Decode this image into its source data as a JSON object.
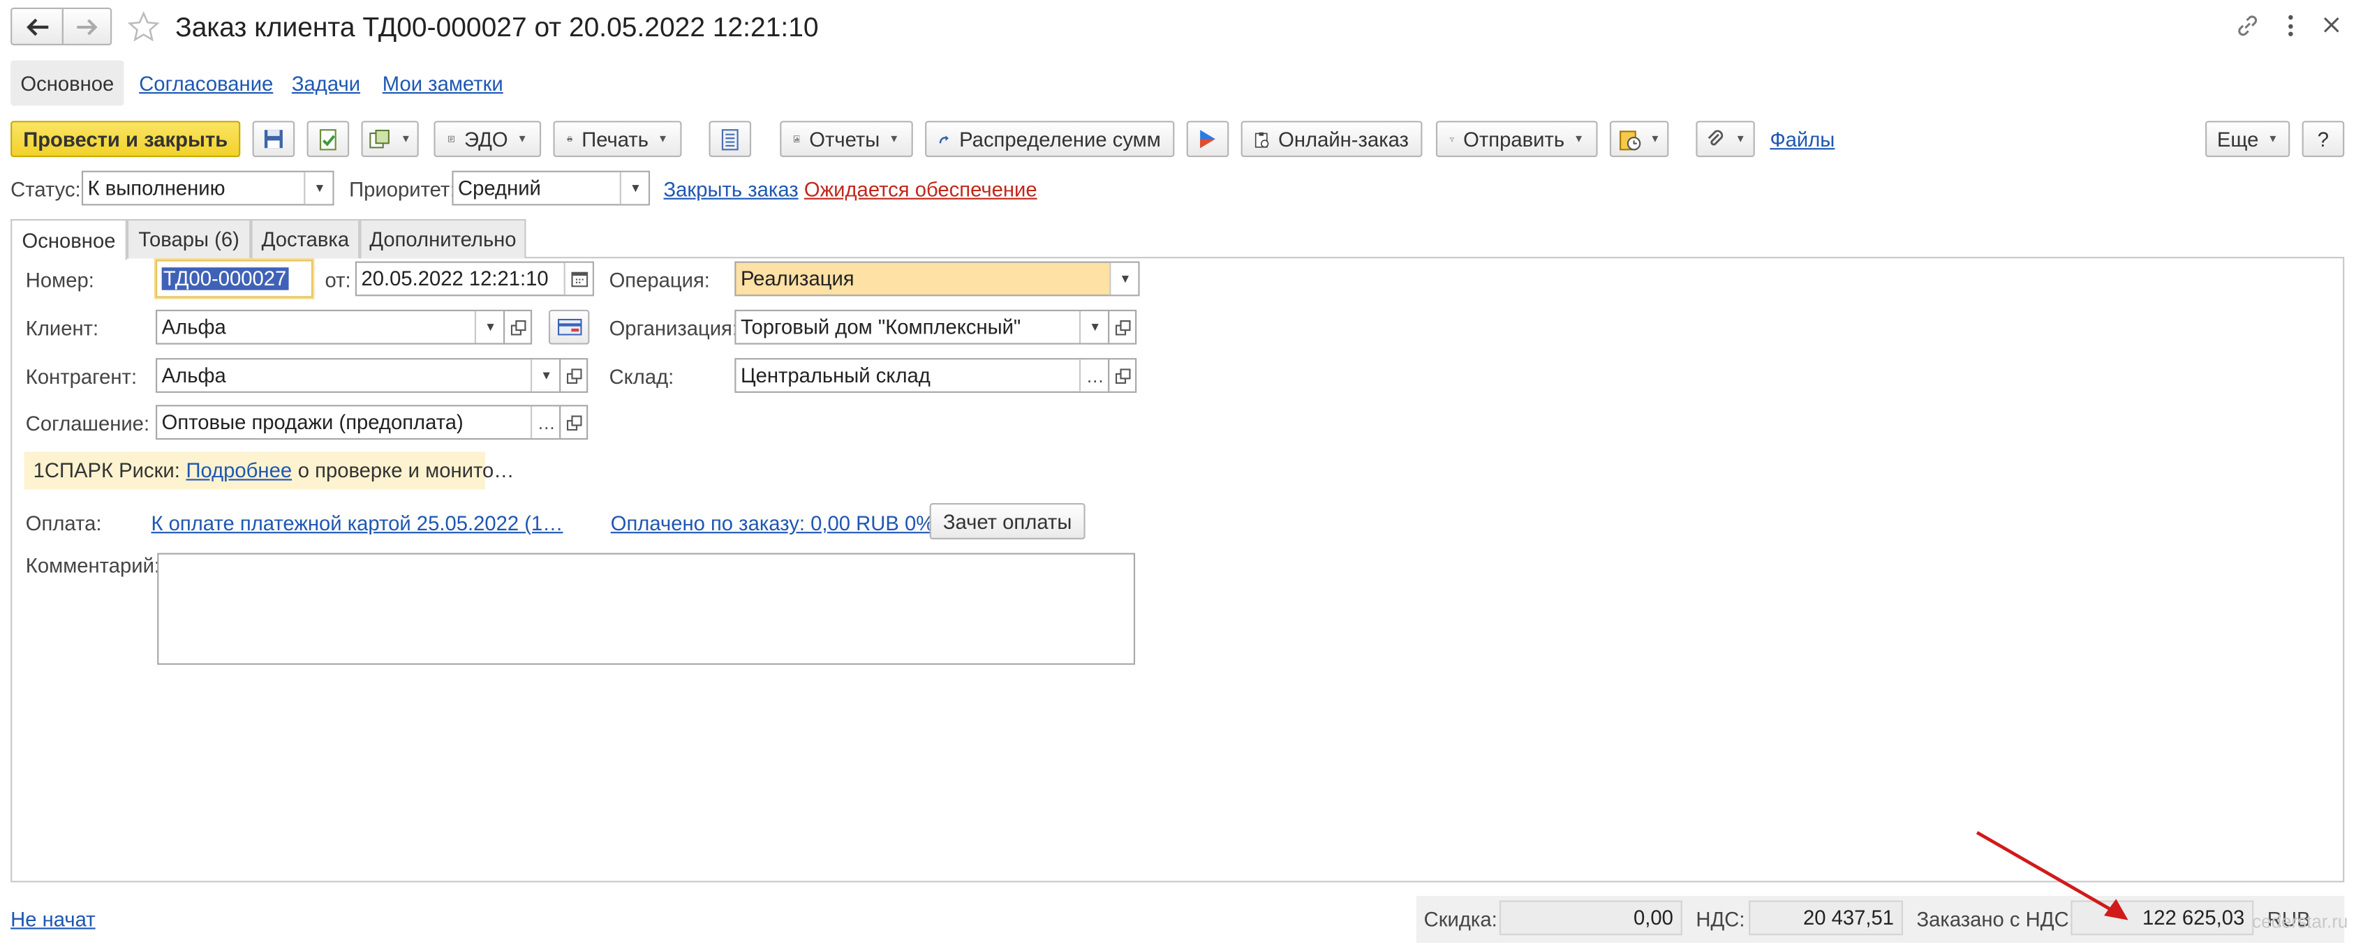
{
  "window": {
    "title": "Заказ клиента ТД00-000027 от 20.05.2022 12:21:10"
  },
  "nav_tabs": [
    {
      "label": "Основное",
      "active": true
    },
    {
      "label": "Согласование"
    },
    {
      "label": "Задачи"
    },
    {
      "label": "Мои заметки"
    }
  ],
  "toolbar": {
    "post_close": "Провести и закрыть",
    "edo": "ЭДО",
    "print": "Печать",
    "reports": "Отчеты",
    "distribute": "Распределение сумм",
    "online_order": "Онлайн-заказ",
    "send": "Отправить",
    "files": "Файлы",
    "more": "Еще",
    "help": "?"
  },
  "status_row": {
    "status_label": "Статус:",
    "status_value": "К выполнению",
    "priority_label": "Приоритет:",
    "priority_value": "Средний",
    "close_order": "Закрыть заказ",
    "awaiting": "Ожидается обеспечение"
  },
  "form_tabs": [
    {
      "label": "Основное",
      "active": true
    },
    {
      "label": "Товары (6)"
    },
    {
      "label": "Доставка"
    },
    {
      "label": "Дополнительно"
    }
  ],
  "form": {
    "number_label": "Номер:",
    "number_value": "ТД00-000027",
    "from_label": "от:",
    "date_value": "20.05.2022 12:21:10",
    "operation_label": "Операция:",
    "operation_value": "Реализация",
    "client_label": "Клиент:",
    "client_value": "Альфа",
    "org_label": "Организация:",
    "org_value": "Торговый дом \"Комплексный\"",
    "contractor_label": "Контрагент:",
    "contractor_value": "Альфа",
    "warehouse_label": "Склад:",
    "warehouse_value": "Центральный склад",
    "agreement_label": "Соглашение:",
    "agreement_value": "Оптовые продажи (предоплата)",
    "spark_prefix": "1СПАРК Риски:",
    "spark_link": "Подробнее",
    "spark_suffix": "о проверке и монито…",
    "payment_label": "Оплата:",
    "payment_link": "К оплате платежной картой 25.05.2022 (1…",
    "paid_link": "Оплачено по заказу: 0,00 RUB 0%",
    "offset_button": "Зачет оплаты",
    "comment_label": "Комментарий:",
    "comment_value": ""
  },
  "footer": {
    "not_started": "Не начат",
    "discount_label": "Скидка:",
    "discount_value": "0,00",
    "vat_label": "НДС:",
    "vat_value": "20 437,51",
    "ordered_label": "Заказано с НДС:",
    "ordered_value": "122 625,03",
    "currency": "RUB",
    "watermark": "cederstar.ru"
  },
  "colors": {
    "primary_button": "#f5d83a",
    "link": "#1e57b3",
    "link_red": "#c0281c",
    "operation_bg": "#fde1a5",
    "spark_bg": "#fdf3d0",
    "arrow": "#d11a1a",
    "selection": "#3f62b8"
  }
}
